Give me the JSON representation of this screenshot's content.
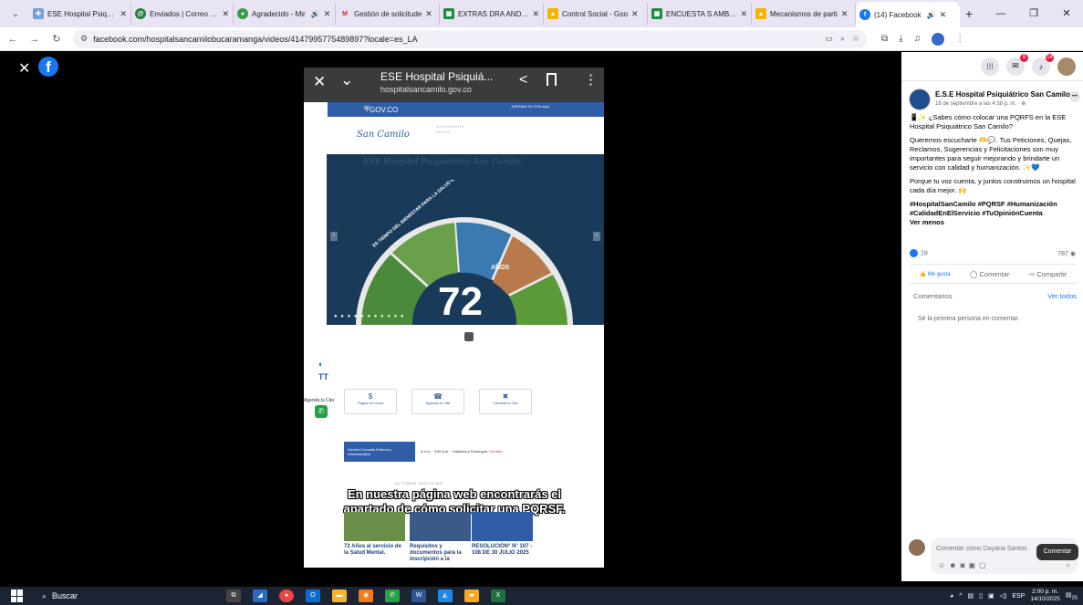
{
  "browser": {
    "tabs": [
      {
        "title": "ESE Hospital Psiquiátr",
        "favicon": "hospital-favicon",
        "color": "#7aa0d8",
        "active": false
      },
      {
        "title": "Enviados | Correo | SC",
        "favicon": "mail-favicon",
        "color": "#2a7d3a",
        "active": false
      },
      {
        "title": "Agradecido - Mir",
        "favicon": "chat-favicon",
        "color": "#3a9a4a",
        "active": false,
        "audio": true
      },
      {
        "title": "Gestión de solicitude",
        "favicon": "m-favicon",
        "color": "#c2331f",
        "active": false
      },
      {
        "title": "EXTRAS DRA ANDRE",
        "favicon": "sheets-favicon",
        "color": "#1e8e3e",
        "active": false
      },
      {
        "title": "Control Social - Goo",
        "favicon": "drive-favicon",
        "color": "#f4b400",
        "active": false
      },
      {
        "title": "ENCUESTA S AMBUL",
        "favicon": "sheets-favicon",
        "color": "#1e8e3e",
        "active": false
      },
      {
        "title": "Mecanismos de parti",
        "favicon": "drive-favicon",
        "color": "#f4b400",
        "active": false
      },
      {
        "title": "(14) Facebook",
        "favicon": "facebook-favicon",
        "color": "#1877f2",
        "active": true,
        "audio": true
      }
    ],
    "url": "facebook.com/hospitalsancamilobucaramanga/videos/4147995775489897?locale=es_LA"
  },
  "video": {
    "site_title": "ESE Hospital Psiquiá...",
    "site_url": "hospitalsancamilo.gov.co",
    "gov_label": "GOV.CO",
    "agenda_label": "AGENDA TU CITA aquí",
    "logo_text": "San Camilo",
    "hero_bg_text": "ESE Hospital Psiquiátrico San Camilo",
    "hero_arc_text": "ES TIEMPO DEL BIENESTAR PARA LA SALUD MENTAL",
    "hero_big_number": "72",
    "hero_anos": "AÑOS",
    "whatsapp_label": "Agenda tu Cita",
    "quick_buttons": [
      {
        "label": "Pagos en Línea",
        "icon": "$"
      },
      {
        "label": "Agenda tu Cita",
        "icon": "☎"
      },
      {
        "label": "Cancela tu Cita",
        "icon": "✖"
      }
    ],
    "horario_title": "Horario Consulta Externa y Administrativa",
    "horario_text": "6 a.m. - 3:00 p.m. - Sábados y Domingos:",
    "horario_closed": "Cerrado",
    "ultimas": "ÚLTIMAS NOTICIAS",
    "caption_line1": "En nuestra página web encontrarás el",
    "caption_line2": "apartado de cómo solicitar una PQRSF.",
    "news": [
      {
        "label": "72 Años al servicio de la Salud Mental.",
        "color": "#6a8e4a"
      },
      {
        "label": "Requisitos y documentos para la inscripción a la",
        "color": "#3a5a8a"
      },
      {
        "label": "RESOLUCIÓN° N° 107 - 108 DE 30 JULIO 2025",
        "color": "#2f5da8"
      }
    ]
  },
  "panel": {
    "page_name": "E.S.E Hospital Psiquiátrico San Camilo",
    "post_date": "18 de septiembre a las 4:38 p. m. · ",
    "post_line1": "📱✨ ¿Sabes cómo colocar una PQRFS en la ESE Hospital Psiquiátrico San Camilo?",
    "post_line2": "Queremos escucharte 🫶💬. Tus Peticiones, Quejas, Reclamos, Sugerencias y Felicitaciones son muy importantes para seguir mejorando y brindarte un servicio con calidad y humanización. ✨💙",
    "post_line3": "Porque tu voz cuenta, y juntos construimos un hospital cada día mejor. 🙌",
    "hashtags": "#HospitalSanCamilo #PQRSF #Humanización #CalidadEnElServicio #TuOpiniónCuenta",
    "see_less": "Ver menos",
    "likes": "18",
    "views": "787",
    "like_label": "Me gusta",
    "comment_label": "Comentar",
    "share_label": "Compartir",
    "comments_title": "Comentarios",
    "see_all": "Ver todos",
    "first_comment": "Sé la primera persona en comentar.",
    "comment_placeholder": "Comentar como Dayana Santos",
    "tooltip": "Comentar",
    "messenger_badge": "8",
    "notif_badge": "14"
  },
  "taskbar": {
    "search": "Buscar",
    "lang": "ESP",
    "time": "2:00 p. m.",
    "date": "14/10/2025",
    "notif_count": "25"
  }
}
